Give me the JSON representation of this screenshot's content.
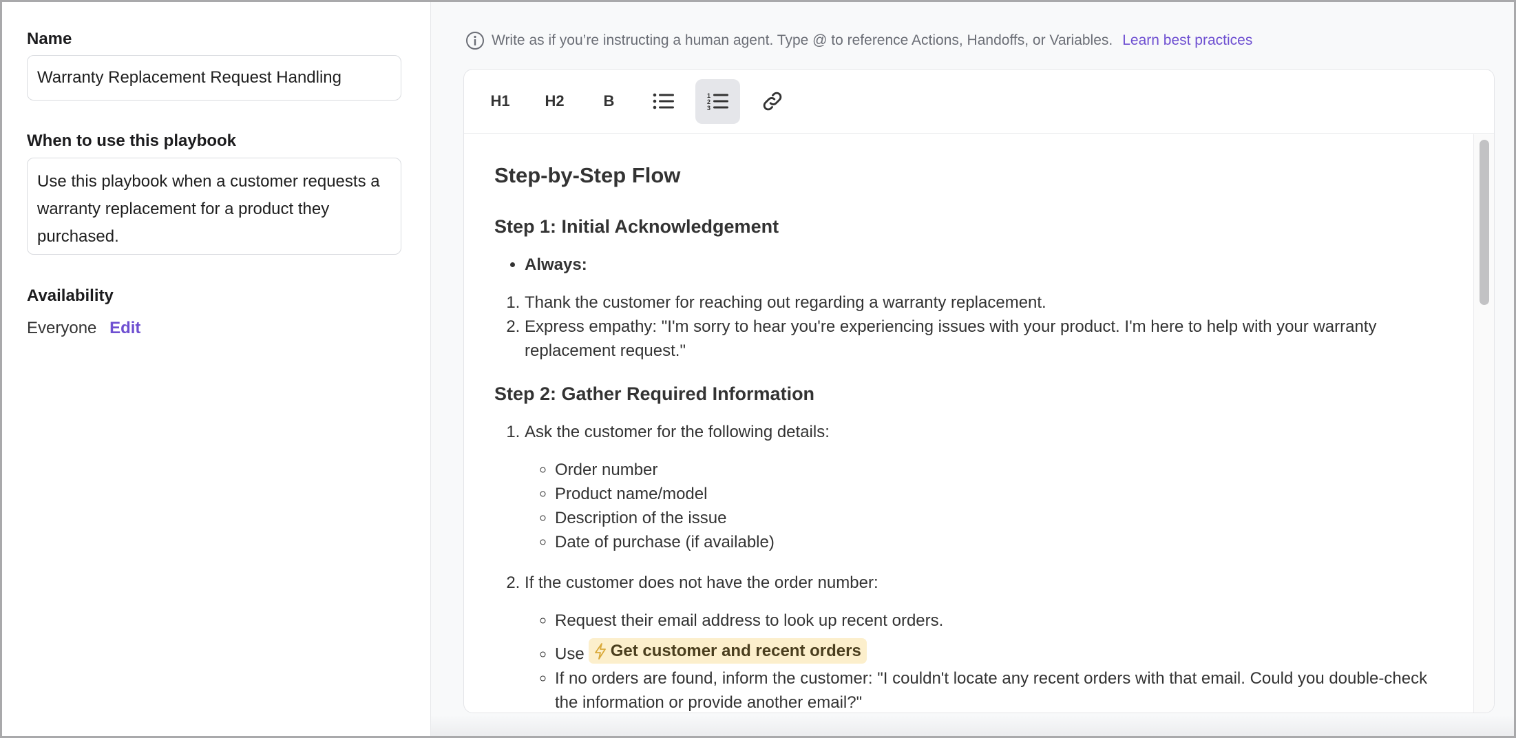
{
  "left": {
    "name_label": "Name",
    "name_value": "Warranty Replacement Request Handling",
    "when_label": "When to use this playbook",
    "when_value": "Use this playbook when a customer requests a warranty replacement for a product they purchased.",
    "availability_label": "Availability",
    "availability_value": "Everyone",
    "edit_link": "Edit"
  },
  "hint": {
    "text": "Write as if you’re instructing a human agent. Type @ to reference Actions, Handoffs, or Variables.",
    "link": "Learn best practices"
  },
  "toolbar": {
    "h1": "H1",
    "h2": "H2",
    "bold": "B"
  },
  "doc": {
    "title": "Step-by-Step Flow",
    "step1": {
      "heading": "Step 1: Initial Acknowledgement",
      "bullet": "Always:",
      "items": [
        "Thank the customer for reaching out regarding a warranty replacement.",
        "Express empathy: \"I'm sorry to hear you're experiencing issues with your product. I'm here to help with your warranty replacement request.\""
      ]
    },
    "step2": {
      "heading": "Step 2: Gather Required Information",
      "item1": "Ask the customer for the following details:",
      "details": [
        "Order number",
        "Product name/model",
        "Description of the issue",
        "Date of purchase (if available)"
      ],
      "item2": "If the customer does not have the order number:",
      "sub": {
        "request": "Request their email address to look up recent orders.",
        "use": "Use",
        "action": "Get customer and recent orders",
        "no_orders": "If no orders are found, inform the customer: \"I couldn't locate any recent orders with that email. Could you double-check the information or provide another email?\""
      }
    }
  },
  "colors": {
    "accent": "#6e4fd1",
    "chip": "#fcefcc"
  }
}
